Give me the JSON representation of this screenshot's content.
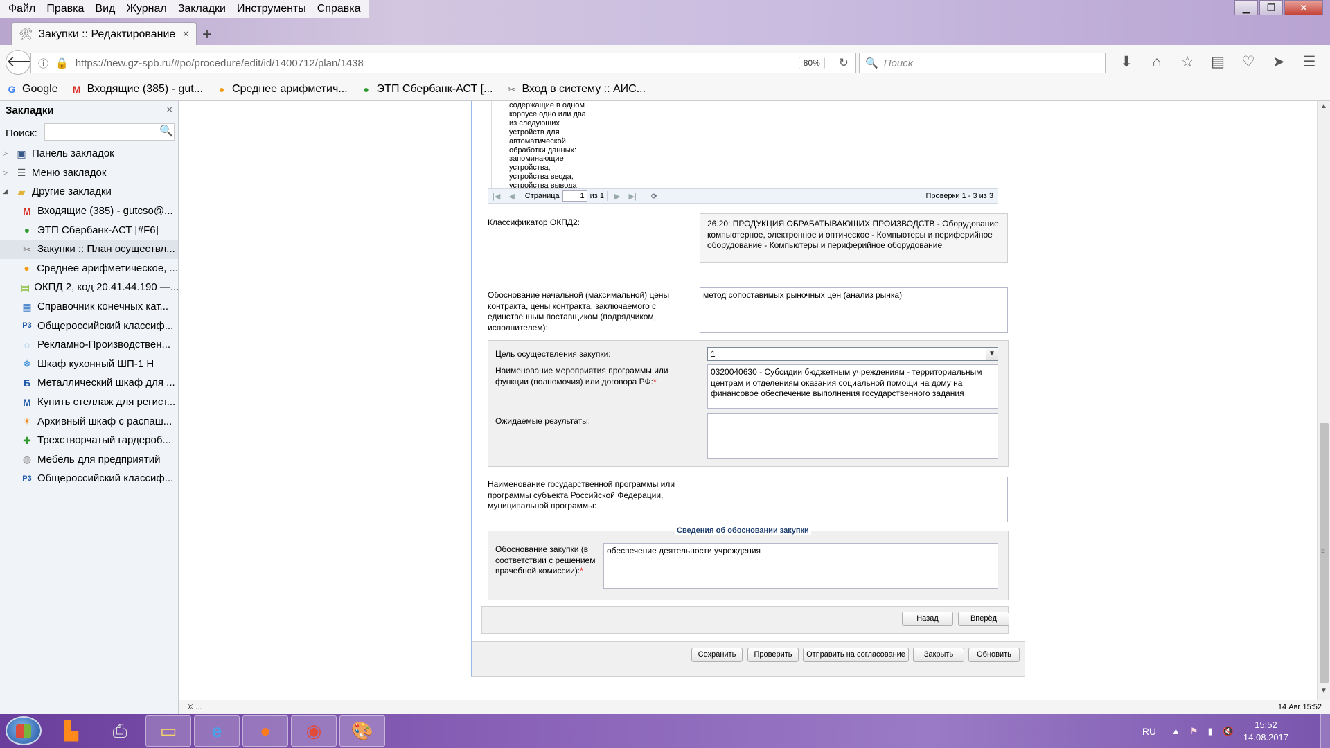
{
  "menu": [
    "Файл",
    "Правка",
    "Вид",
    "Журнал",
    "Закладки",
    "Инструменты",
    "Справка"
  ],
  "tab": {
    "title": "Закупки :: Редактирование",
    "close": "×",
    "new_tab": "+"
  },
  "nav": {
    "url": "https://new.gz-spb.ru/#po/procedure/edit/id/1400712/plan/1438",
    "zoom": "80%",
    "search_placeholder": "Поиск"
  },
  "bookmarks_bar": [
    {
      "label": "Google",
      "icon": "google-icon"
    },
    {
      "label": "Входящие (385) - gut...",
      "icon": "gmail-icon"
    },
    {
      "label": "Среднее арифметич...",
      "icon": "orange-dot-icon"
    },
    {
      "label": "ЭТП Сбербанк-АСТ [...",
      "icon": "sberbank-icon"
    },
    {
      "label": "Вход в систему :: АИС...",
      "icon": "tools-icon"
    }
  ],
  "sidebar": {
    "title": "Закладки",
    "close": "×",
    "search_label": "Поиск:",
    "items": [
      {
        "label": "Панель закладок",
        "icon": "toolbar-folder-icon",
        "level": 0,
        "twisty": "▷"
      },
      {
        "label": "Меню закладок",
        "icon": "menu-folder-icon",
        "level": 0,
        "twisty": "▷"
      },
      {
        "label": "Другие закладки",
        "icon": "folder-icon",
        "level": 0,
        "twisty": "◢"
      },
      {
        "label": "Входящие (385) - gutcso@...",
        "icon": "gmail-icon",
        "level": 1
      },
      {
        "label": "ЭТП Сбербанк-АСТ [#F6]",
        "icon": "sberbank-icon",
        "level": 1
      },
      {
        "label": "Закупки :: План осуществл...",
        "icon": "tools-icon",
        "level": 1,
        "selected": true
      },
      {
        "label": "Среднее арифметическое, ...",
        "icon": "orange-dot-icon",
        "level": 1
      },
      {
        "label": "ОКПД 2, код 20.41.44.190 —...",
        "icon": "document-icon",
        "level": 1
      },
      {
        "label": "Справочник конечных кат...",
        "icon": "catalog-icon",
        "level": 1
      },
      {
        "label": "Общероссийский классиф...",
        "icon": "p3-icon",
        "level": 1
      },
      {
        "label": "Рекламно-Производствен...",
        "icon": "circle-logo-icon",
        "level": 1
      },
      {
        "label": "Шкаф кухонный ШП-1 Н",
        "icon": "snowflake-icon",
        "level": 1
      },
      {
        "label": "Металлический шкаф для ...",
        "icon": "b-icon",
        "level": 1
      },
      {
        "label": "Купить стеллаж для регист...",
        "icon": "m-icon",
        "level": 1
      },
      {
        "label": "Архивный шкаф с распаш...",
        "icon": "orange-logo-icon",
        "level": 1
      },
      {
        "label": "Трехстворчатый гардероб...",
        "icon": "green-plus-icon",
        "level": 1
      },
      {
        "label": "Мебель для предприятий",
        "icon": "globe-icon",
        "level": 1
      },
      {
        "label": "Общероссийский классиф...",
        "icon": "p3-icon",
        "level": 1
      }
    ]
  },
  "grid": {
    "cell_lines": [
      "содержащие в одном",
      "корпусе одно или два",
      "из следующих",
      "устройств для",
      "автоматической",
      "обработки данных:",
      "запоминающие",
      "устройства,",
      "устройства ввода,",
      "устройства вывода"
    ],
    "pager": {
      "page_label": "Страница",
      "page_value": "1",
      "of_label": "из 1",
      "records": "Проверки 1 - 3 из 3"
    }
  },
  "form": {
    "okpd_label": "Классификатор ОКПД2:",
    "okpd_value": "26.20: ПРОДУКЦИЯ ОБРАБАТЫВАЮЩИХ ПРОИЗВОДСТВ - Оборудование компьютерное, электронное и оптическое - Компьютеры и периферийное оборудование - Компьютеры и периферийное оборудование",
    "nmck_label": "Обоснование начальной (максимальной) цены контракта, цены контракта, заключаемого с единственным поставщиком (подрядчиком, исполнителем):",
    "nmck_value": "метод сопоставимых рыночных цен (анализ рынка)",
    "goal_label": "Цель осуществления закупки:",
    "goal_value": "1",
    "event_label": "Наименование мероприятия программы или функции (полномочия) или договора РФ:",
    "event_value": "0320040630 - Субсидии бюджетным учреждениям - территориальным центрам и отделениям оказания социальной помощи на дому на финансовое обеспечение выполнения государственного задания",
    "results_label": "Ожидаемые результаты:",
    "results_value": "",
    "program_label": "Наименование государственной программы или программы субъекта Российской Федерации, муниципальной программы:",
    "program_value": "",
    "justification_legend": "Сведения об обосновании закупки",
    "justification_label": "Обоснование закупки (в соответствии с решением врачебной комиссии):",
    "justification_value": "обеспечение деятельности учреждения",
    "required_mark": "*"
  },
  "buttons": {
    "back": "Назад",
    "forward": "Вперёд",
    "save": "Сохранить",
    "check": "Проверить",
    "send": "Отправить на согласование",
    "close": "Закрыть",
    "refresh": "Обновить"
  },
  "statusbar": {
    "left": "© ...",
    "right": "14 Авг 15:52"
  },
  "taskbar": {
    "lang": "RU",
    "time": "15:52",
    "date": "14.08.2017"
  }
}
